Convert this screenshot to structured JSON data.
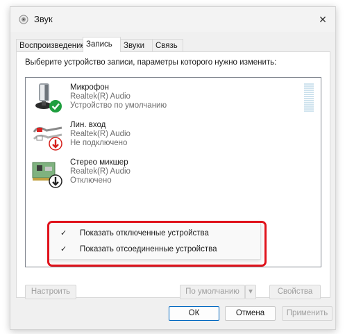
{
  "window": {
    "title": "Звук",
    "close_glyph": "✕"
  },
  "tabs": [
    {
      "label": "Воспроизведение",
      "active": false
    },
    {
      "label": "Запись",
      "active": true
    },
    {
      "label": "Звуки",
      "active": false
    },
    {
      "label": "Связь",
      "active": false
    }
  ],
  "instruction": "Выберите устройство записи, параметры которого нужно изменить:",
  "devices": [
    {
      "name": "Микрофон",
      "driver": "Realtek(R) Audio",
      "status": "Устройство по умолчанию",
      "icon": "microphone-icon",
      "badge": "check-badge-icon",
      "badge_color": "#1e9e3e"
    },
    {
      "name": "Лин. вход",
      "driver": "Realtek(R) Audio",
      "status": "Не подключено",
      "icon": "line-in-cable-icon",
      "badge": "arrow-down-badge-icon",
      "badge_color": "#d6201c"
    },
    {
      "name": "Стерео микшер",
      "driver": "Realtek(R) Audio",
      "status": "Отключено",
      "icon": "sound-card-icon",
      "badge": "arrow-down-badge-icon",
      "badge_color": "#222222"
    }
  ],
  "context_menu": [
    {
      "label": "Показать отключенные устройства",
      "checked": true
    },
    {
      "label": "Показать отсоединенные устройства",
      "checked": true
    }
  ],
  "check_glyph": "✓",
  "buttons": {
    "configure": "Настроить",
    "default": "По умолчанию",
    "default_arrow": "▾",
    "properties": "Свойства",
    "ok": "ОК",
    "cancel": "Отмена",
    "apply": "Применить"
  },
  "colors": {
    "highlight": "#e0121b",
    "accent": "#0067c0"
  }
}
